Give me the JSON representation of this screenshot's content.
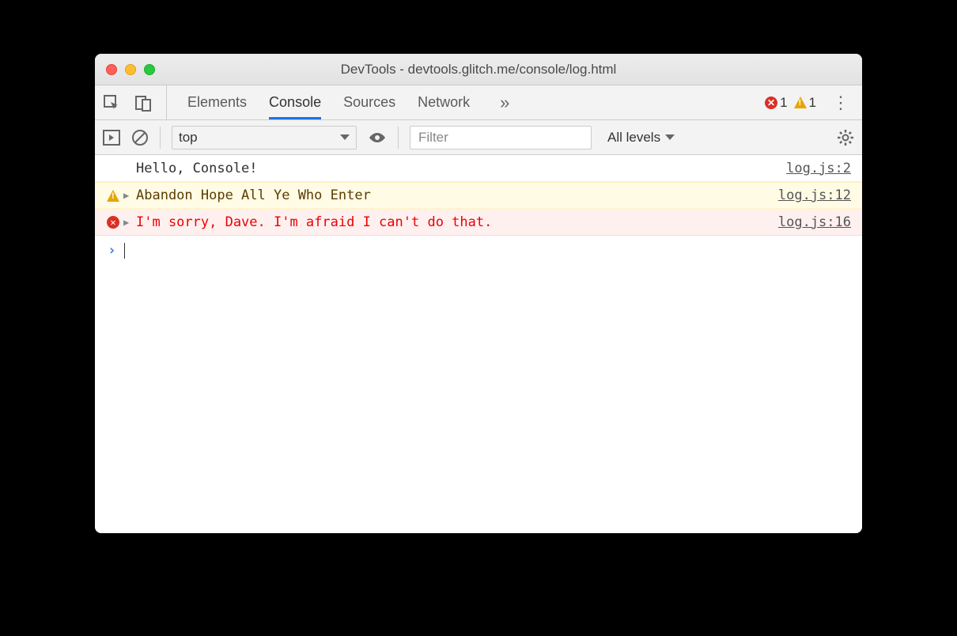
{
  "window": {
    "title": "DevTools - devtools.glitch.me/console/log.html"
  },
  "tabs": {
    "items": [
      "Elements",
      "Console",
      "Sources",
      "Network"
    ],
    "active": "Console",
    "overflow_glyph": "»"
  },
  "status": {
    "error_count": "1",
    "warning_count": "1"
  },
  "toolbar": {
    "context": "top",
    "filter_placeholder": "Filter",
    "levels_label": "All levels"
  },
  "logs": [
    {
      "type": "log",
      "message": "Hello, Console!",
      "source": "log.js:2"
    },
    {
      "type": "warn",
      "message": "Abandon Hope All Ye Who Enter",
      "source": "log.js:12"
    },
    {
      "type": "error",
      "message": "I'm sorry, Dave. I'm afraid I can't do that.",
      "source": "log.js:16"
    }
  ],
  "prompt": {
    "chevron": "›"
  }
}
